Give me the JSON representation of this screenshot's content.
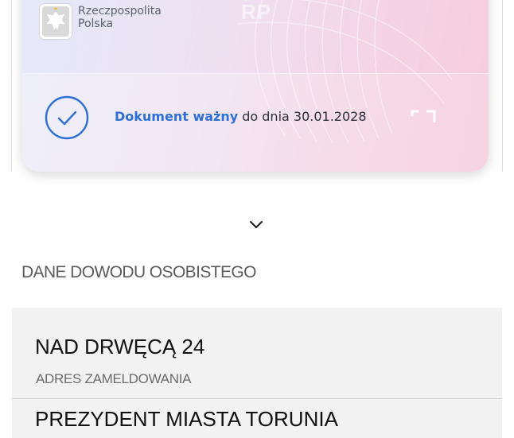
{
  "card": {
    "country_line1": "Rzeczpospolita",
    "country_line2": "Polska",
    "watermark": "RP",
    "validity_status": "Dokument ważny",
    "validity_suffix": " do dnia 30.01.2028",
    "accent_color": "#2d6fd6",
    "icons": [
      "polish-eagle-emblem-icon",
      "check-circle-icon",
      "qr-corner-icon"
    ]
  },
  "expand": {
    "icon": "chevron-down-icon"
  },
  "section": {
    "title": "DANE DOWODU OSOBISTEGO"
  },
  "fields": [
    {
      "value": "NAD DRWĘCĄ 24",
      "label": "ADRES ZAMELDOWANIA"
    },
    {
      "value": "PREZYDENT MIASTA TORUNIA",
      "label": ""
    }
  ]
}
